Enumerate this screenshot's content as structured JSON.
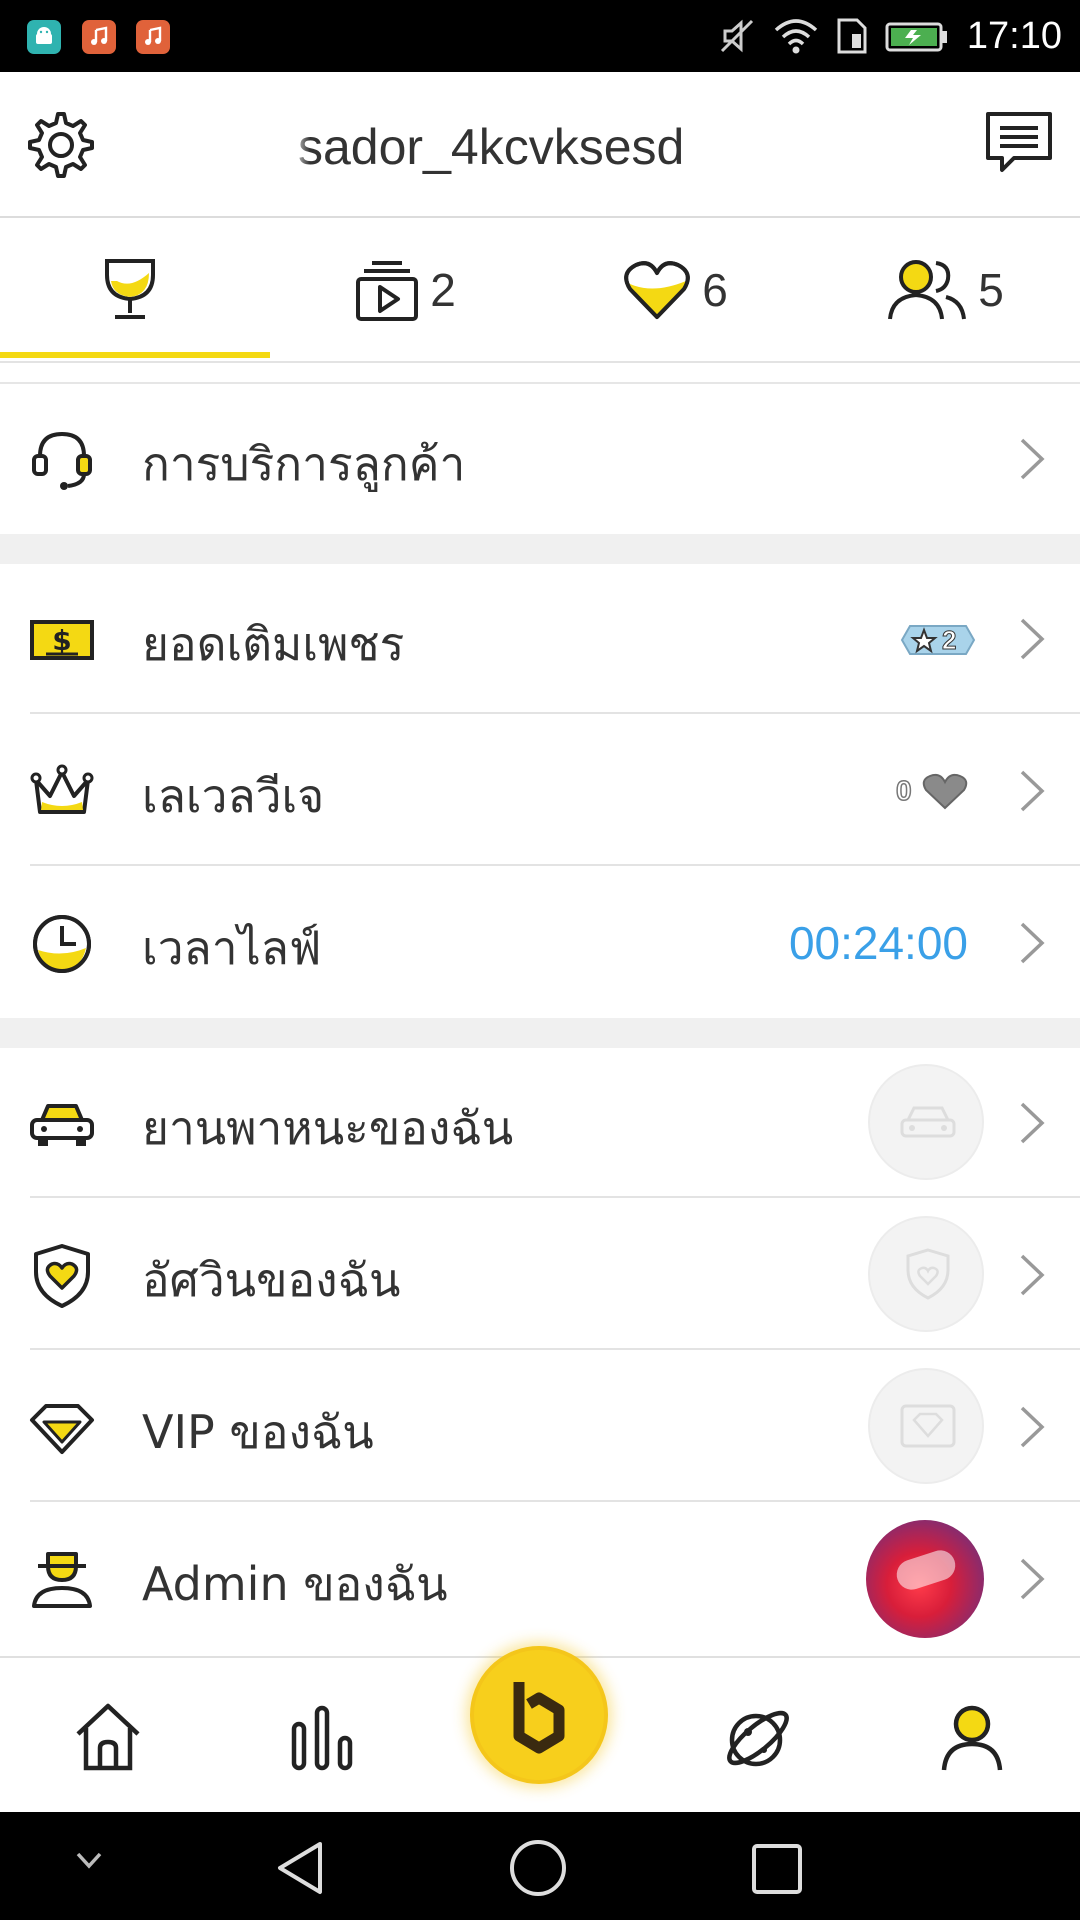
{
  "status_bar": {
    "time": "17:10",
    "icons": [
      "android-icon",
      "music-icon",
      "music-icon",
      "mute-icon",
      "wifi-icon",
      "sim-icon",
      "battery-icon"
    ]
  },
  "header": {
    "username": "sador_4kcvksesd",
    "left_icon": "gear-icon",
    "right_icon": "message-icon"
  },
  "tabs": [
    {
      "icon": "trophy-icon",
      "count": ""
    },
    {
      "icon": "video-stack-icon",
      "count": "2"
    },
    {
      "icon": "heart-icon",
      "count": "6"
    },
    {
      "icon": "people-icon",
      "count": "5"
    }
  ],
  "menu": {
    "customer_service": "การบริการลูกค้า",
    "diamond_topup": "ยอดเติมเพชร",
    "diamond_badge_level": "2",
    "vj_level": "เลเวลวีเจ",
    "vj_level_value": "0",
    "live_time": "เวลาไลฟ์",
    "live_time_value": "00:24:00",
    "my_vehicle": "ยานพาหนะของฉัน",
    "my_guardian": "อัศวินของฉัน",
    "my_vip": "VIP ของฉัน",
    "my_admin": "Admin ของฉัน"
  },
  "colors": {
    "accent_yellow": "#f4d913",
    "live_time_blue": "#3aa0e8",
    "text": "#333333"
  },
  "bottom_nav": [
    "home-icon",
    "ranking-icon",
    "bigo-center-icon",
    "explore-planet-icon",
    "profile-icon"
  ]
}
